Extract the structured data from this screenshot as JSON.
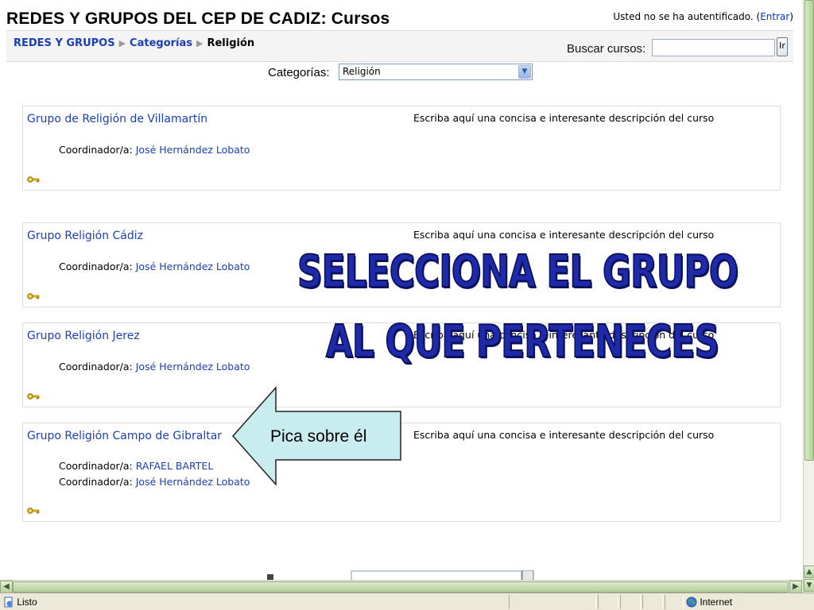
{
  "page": {
    "title": "REDES Y GRUPOS DEL CEP DE CADIZ: Cursos",
    "login_text": "Usted no se ha autentificado. (",
    "login_link": "Entrar",
    "login_close": ")"
  },
  "breadcrumb": {
    "items": [
      "REDES Y GRUPOS",
      "Categorías",
      "Religión"
    ]
  },
  "search": {
    "label": "Buscar cursos:",
    "value": "",
    "button_label": "Ir"
  },
  "category": {
    "label": "Categorías:",
    "selected": "Religión"
  },
  "coord_label": "Coordinador/a:",
  "courses": [
    {
      "name": "Grupo de Religión de Villamartín",
      "summary": "Escriba aquí una concisa e interesante descripción del curso",
      "coordinators": [
        "José Hernández Lobato"
      ]
    },
    {
      "name": "Grupo Religión Cádiz",
      "summary": "Escriba aquí una concisa e interesante descripción del curso",
      "coordinators": [
        "José Hernández Lobato"
      ]
    },
    {
      "name": "Grupo Religión Jerez",
      "summary": "Escriba aquí una concisa e interesante descripción del curso",
      "coordinators": [
        "José Hernández Lobato"
      ]
    },
    {
      "name": "Grupo Religión Campo de Gibraltar",
      "summary": "Escriba aquí una concisa e interesante descripción del curso",
      "coordinators": [
        "RAFAEL BARTEL",
        "José Hernández Lobato"
      ]
    }
  ],
  "overlay": {
    "line1": "SELECCIONA EL GRUPO",
    "line2": "AL QUE PERTENECES",
    "callout": "Pica sobre él"
  },
  "status": {
    "left": "Listo",
    "zone": "Internet"
  },
  "colors": {
    "link": "#1a3fb5",
    "overlay_text": "#1f2aa8",
    "callout_fill": "#c9ecef"
  },
  "icons": [
    "key-icon",
    "page-icon",
    "globe-icon"
  ]
}
